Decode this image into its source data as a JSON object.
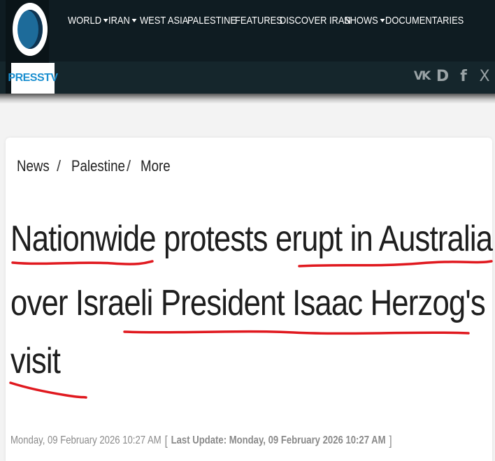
{
  "header": {
    "logo_text": "PRESSTV",
    "nav": [
      {
        "label": "WORLD",
        "dropdown": true
      },
      {
        "label": "IRAN",
        "dropdown": true
      },
      {
        "label": "WEST ASIA",
        "dropdown": false
      },
      {
        "label": "PALESTINE",
        "dropdown": false
      },
      {
        "label": "FEATURES",
        "dropdown": false
      },
      {
        "label": "DISCOVER IRAN",
        "dropdown": false
      },
      {
        "label": "SHOWS",
        "dropdown": true
      },
      {
        "label": "DOCUMENTARIES",
        "dropdown": false
      }
    ],
    "social": [
      {
        "name": "vk-icon",
        "glyph": "VK"
      },
      {
        "name": "rumble-icon",
        "glyph": "D"
      },
      {
        "name": "facebook-icon",
        "glyph": "f"
      },
      {
        "name": "x-icon",
        "glyph": "X"
      }
    ]
  },
  "breadcrumb": {
    "items": [
      "News",
      "Palestine",
      "More"
    ],
    "separator": "/"
  },
  "article": {
    "headline_lines": [
      "Nationwide protests erupt in Australia",
      "over Israeli President Isaac Herzog's",
      "visit"
    ],
    "published": "Monday, 09 February 2026 10:27 AM",
    "last_update_label": "Last Update: Monday, 09 February 2026 10:27 AM"
  },
  "colors": {
    "header_bg": "#0f1c22",
    "logo_blue": "#1b8fd0",
    "annotation_red": "#e0191f",
    "headline_text": "#1e1e1e",
    "meta_text": "#8a8a8a"
  }
}
